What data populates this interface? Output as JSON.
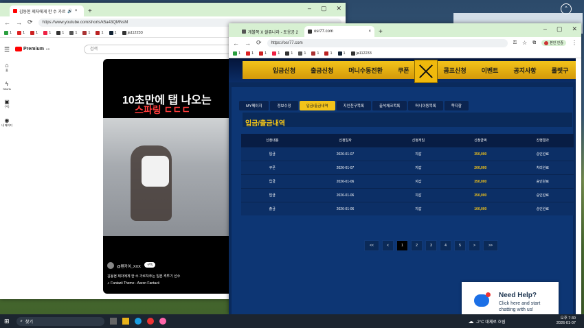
{
  "desktop": {
    "corner_icon": "circle-arrow-up-icon"
  },
  "yt_window": {
    "tab_title": "김동현 제자에게 한 수 가르",
    "url": "https://www.youtube.com/shorts/k5a43QMNsM",
    "bookmarks": [
      "1",
      "1",
      "1",
      "1",
      "1",
      "1",
      "1",
      "1",
      "1",
      "ja112233"
    ],
    "logo_text": "Premium",
    "logo_sup": "KR",
    "search_placeholder": "검색",
    "sidebar": [
      {
        "label": "홈",
        "icon": "home-icon"
      },
      {
        "label": "Shorts",
        "icon": "shorts-icon"
      },
      {
        "label": "구독",
        "icon": "subscriptions-icon"
      },
      {
        "label": "내 페이지",
        "icon": "user-icon"
      }
    ],
    "short": {
      "caption_line1": "10초만에 탭 나오는",
      "caption_line2": "스파링 ㄷㄷㄷ",
      "channel": "@펜카이_XXX",
      "subscribe": "구독",
      "description": "김동현 제자에게 한 수 가르쳐주는 일본 격투기 선수",
      "music": "♫ Fantazii Theme - Aaron Fantazii"
    }
  },
  "site_window": {
    "tab1": "게볼쪽 X 쌀쥬나라 - 토응공 2",
    "tab2": "osr77.com",
    "url": "https://osr77.com",
    "profile_label": "본인 인증",
    "bookmarks": [
      "1",
      "1",
      "1",
      "1",
      "1",
      "1",
      "1",
      "1",
      "1",
      "ja112233"
    ],
    "nav": [
      "입금신청",
      "출금신청",
      "머니수동전환",
      "쿠폰",
      "콤프신청",
      "이벤트",
      "공지사항",
      "롤렛구"
    ],
    "subtabs": [
      "MY페이지",
      "정보수정",
      "입금/출금내역",
      "지인친구목록",
      "출석체크목록",
      "머니이동목록",
      "쪽지함"
    ],
    "active_subtab": 2,
    "section_title": "입금/출금내역",
    "table": {
      "headers": [
        "신청내용",
        "신청일자",
        "신청게임",
        "신청금액",
        "진행결과"
      ],
      "rows": [
        [
          "입금",
          "2026-01-07",
          "지갑",
          "350,000",
          "승인완료"
        ],
        [
          "쿠폰",
          "2026-01-07",
          "지갑",
          "200,000",
          "처리완료"
        ],
        [
          "입금",
          "2026-01-06",
          "지갑",
          "350,000",
          "승인완료"
        ],
        [
          "입금",
          "2026-01-06",
          "지갑",
          "350,000",
          "승인완료"
        ],
        [
          "출금",
          "2026-01-06",
          "지갑",
          "100,000",
          "승인완료"
        ]
      ]
    },
    "pager": [
      "<<",
      "<",
      "1",
      "2",
      "3",
      "4",
      "5",
      ">",
      ">>"
    ],
    "help": {
      "title": "Need Help?",
      "body1": "Click here and start",
      "body2": "chatting with us!"
    }
  },
  "taskbar": {
    "search": "찾기",
    "weather": "-2°C 대체로 흐림",
    "time": "오후 7:30",
    "date": "2026-01-07"
  },
  "colors": {
    "gold": "#f2c31a",
    "navy": "#0d3674",
    "yt_red": "#ff0000"
  }
}
